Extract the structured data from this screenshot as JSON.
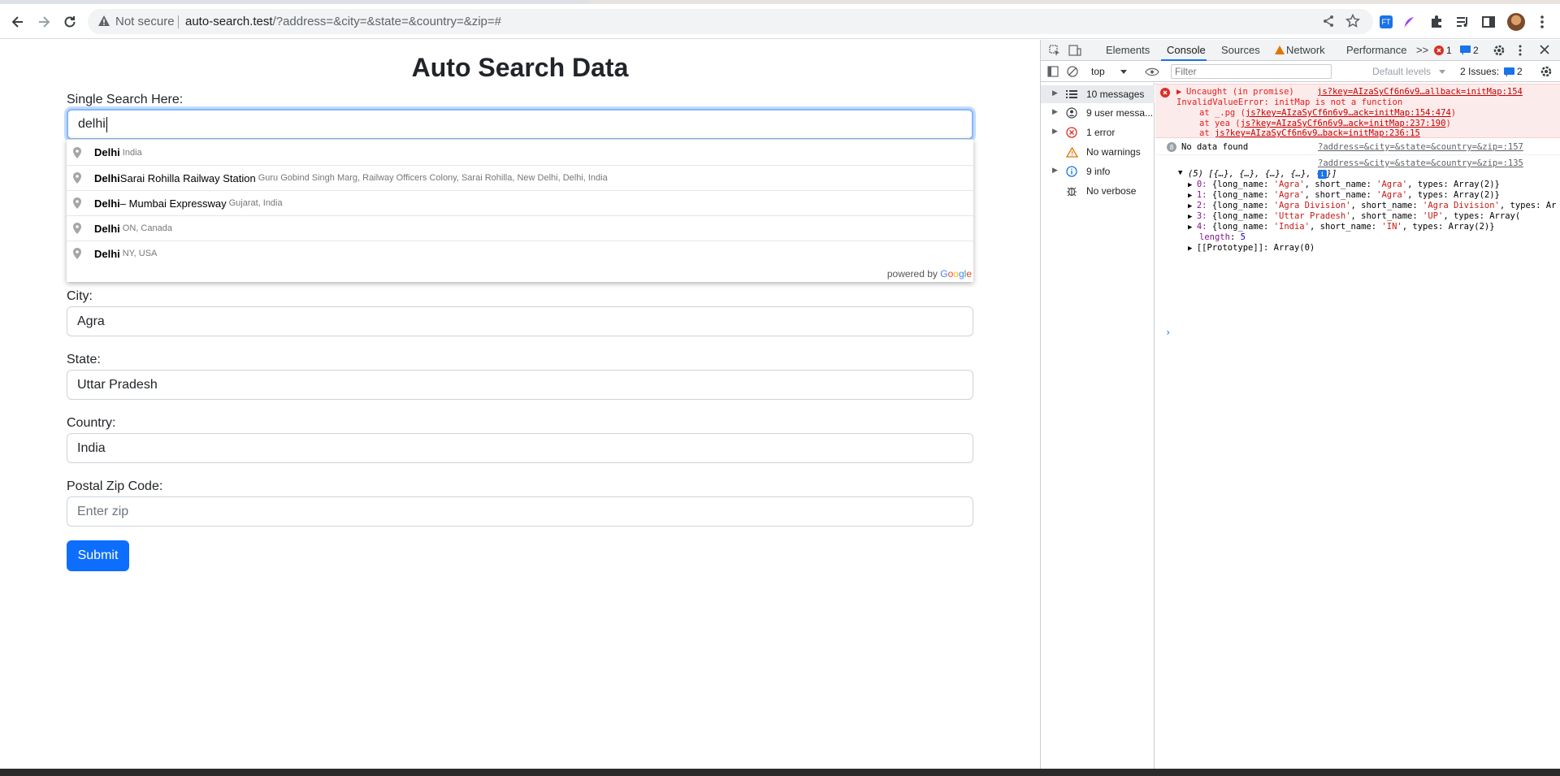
{
  "browser": {
    "security_label": "Not secure",
    "url_host": "auto-search.test",
    "url_path": "/?address=&city=&state=&country=&zip=#"
  },
  "page": {
    "title": "Auto Search Data",
    "single_search_label": "Single Search Here:",
    "single_search_value": "delhi",
    "city_label": "City:",
    "city_value": "Agra",
    "state_label": "State:",
    "state_value": "Uttar Pradesh",
    "country_label": "Country:",
    "country_value": "India",
    "zip_label": "Postal Zip Code:",
    "zip_placeholder": "Enter zip",
    "submit_label": "Submit"
  },
  "autocomplete": {
    "items": [
      {
        "main": "Delhi",
        "rest": "",
        "secondary": "India"
      },
      {
        "main": "Delhi",
        "rest": " Sarai Rohilla Railway Station",
        "secondary": "Guru Gobind Singh Marg, Railway Officers Colony, Sarai Rohilla, New Delhi, Delhi, India"
      },
      {
        "main": "Delhi",
        "rest": " – Mumbai Expressway",
        "secondary": "Gujarat, India"
      },
      {
        "main": "Delhi",
        "rest": "",
        "secondary": "ON, Canada"
      },
      {
        "main": "Delhi",
        "rest": "",
        "secondary": "NY, USA"
      }
    ],
    "powered_by": "powered by",
    "google": [
      "G",
      "o",
      "o",
      "g",
      "l",
      "e"
    ]
  },
  "devtools": {
    "tabs": [
      "Elements",
      "Console",
      "Sources",
      "Network",
      "Performance"
    ],
    "overflow": ">>",
    "error_count": "1",
    "issue_count_badge": "2",
    "context": "top",
    "filter_placeholder": "Filter",
    "levels": "Default levels",
    "issues_label": "2 Issues:",
    "issues_count": "2",
    "sidebar": [
      {
        "label": "10 messages"
      },
      {
        "label": "9 user messa..."
      },
      {
        "label": "1 error"
      },
      {
        "label": "No warnings"
      },
      {
        "label": "9 info"
      },
      {
        "label": "No verbose"
      }
    ],
    "error": {
      "title": "Uncaught (in promise)",
      "source": "js?key=AIzaSyCf6n6v9…allback=initMap:154",
      "message": "InvalidValueError: initMap is not a function",
      "stack": [
        {
          "prefix": "at _.pg (",
          "link": "js?key=AIzaSyCf6n6v9…ack=initMap:154:474",
          "suffix": ")"
        },
        {
          "prefix": "at yea (",
          "link": "js?key=AIzaSyCf6n6v9…ack=initMap:237:190",
          "suffix": ")"
        },
        {
          "prefix": "at ",
          "link": "js?key=AIzaSyCf6n6v9…back=initMap:236:15",
          "suffix": ""
        }
      ]
    },
    "log1": {
      "count": "8",
      "text": "No data found",
      "source": "?address=&city=&state=&country=&zip=:157"
    },
    "log2": {
      "source": "?address=&city=&state=&country=&zip=:135",
      "summary": "(5) [{…}, {…}, {…}, {…}, {…}]"
    },
    "array_items": [
      {
        "idx": "0",
        "long": "'Agra'",
        "short": "'Agra'",
        "types": "Array(2)}"
      },
      {
        "idx": "1",
        "long": "'Agra'",
        "short": "'Agra'",
        "types": "Array(2)}"
      },
      {
        "idx": "2",
        "long": "'Agra Division'",
        "short": "'Agra Division'",
        "types": "Ar"
      },
      {
        "idx": "3",
        "long": "'Uttar Pradesh'",
        "short": "'UP'",
        "types": "Array("
      },
      {
        "idx": "4",
        "long": "'India'",
        "short": "'IN'",
        "types": "Array(2)}"
      }
    ],
    "length_label": "length",
    "length_value": "5",
    "prototype": "[[Prototype]]: Array(0)"
  }
}
